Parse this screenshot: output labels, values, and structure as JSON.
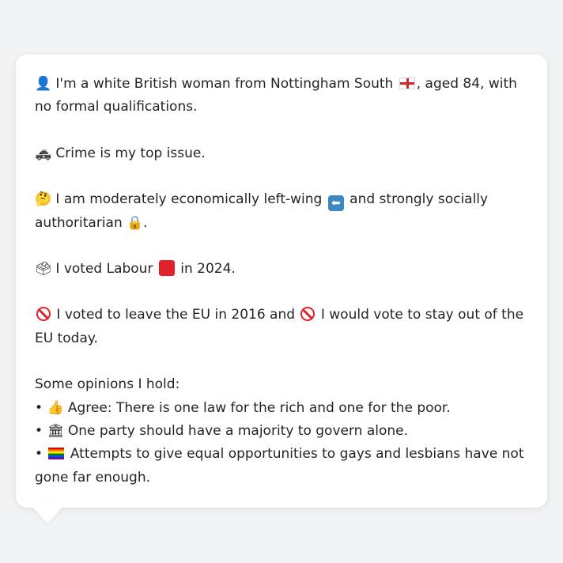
{
  "profile": {
    "intro_pre": "I'm a white British woman from Nottingham South",
    "intro_post": ", aged 84, with no formal qualifications.",
    "issue": "Crime is my top issue.",
    "economic_pre": "I am moderately economically left-wing",
    "economic_mid": "and strongly socially authoritarian",
    "economic_post": ".",
    "vote_pre": "I voted Labour",
    "vote_post": "in 2024.",
    "eu_pre": "I voted to leave the EU in 2016 and",
    "eu_post": "I would vote to stay out of the EU today."
  },
  "opinions": {
    "heading": "Some opinions I hold:",
    "bullet": "•",
    "items": [
      "Agree: There is one law for the rich and one for the poor.",
      "One party should have a majority to govern alone.",
      "Attempts to give equal opportunities to gays and lesbians have not gone far enough."
    ]
  },
  "icons": {
    "person": "bust-in-silhouette-icon",
    "england_flag": "england-flag-icon",
    "police_car": "police-car-icon",
    "thinking": "thinking-face-icon",
    "left_arrow": "left-arrow-icon",
    "lock": "lock-icon",
    "ballot": "ballot-box-icon",
    "labour_square": "red-square-icon",
    "no_entry": "prohibited-icon",
    "thumbs_up": "thumbs-up-icon",
    "classical_building": "classical-building-icon",
    "rainbow_flag": "rainbow-flag-icon"
  },
  "colors": {
    "background": "#f2f3f5",
    "card": "#ffffff",
    "text": "#1f2328",
    "labour_red": "#e0232a"
  }
}
